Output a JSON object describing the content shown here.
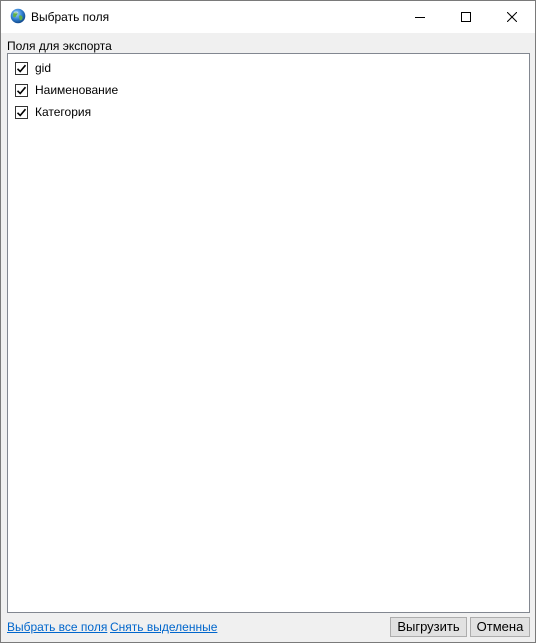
{
  "window": {
    "title": "Выбрать поля",
    "icon": "globe-icon"
  },
  "fields_panel": {
    "label": "Поля для экспорта",
    "items": [
      {
        "label": "gid",
        "checked": true
      },
      {
        "label": "Наименование",
        "checked": true
      },
      {
        "label": "Категория",
        "checked": true
      }
    ]
  },
  "links": {
    "select_all": "Выбрать все поля",
    "deselect": "Снять выделенные"
  },
  "buttons": {
    "export": "Выгрузить",
    "cancel": "Отмена"
  },
  "colors": {
    "link": "#0066cc",
    "window_bg": "#f0f0f0",
    "list_bg": "#ffffff"
  }
}
